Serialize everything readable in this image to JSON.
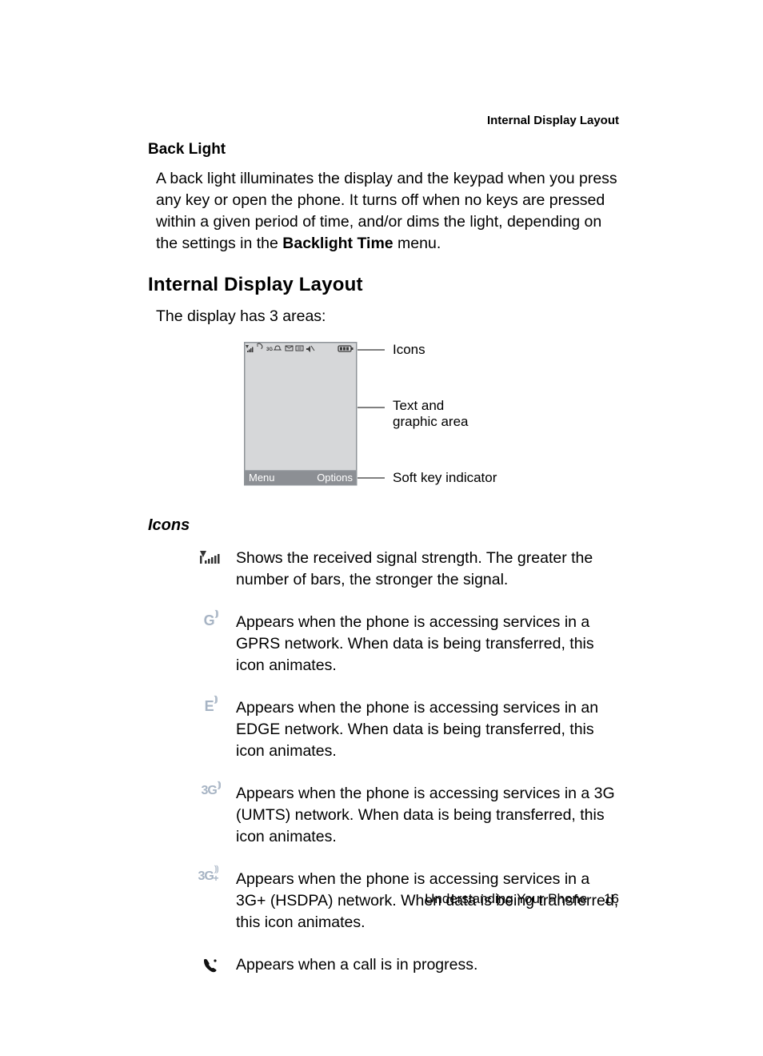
{
  "running_head": "Internal Display Layout",
  "section_backlight": {
    "heading": "Back Light",
    "para_before": "A back light illuminates the display and the keypad when you press any key or open the phone. It turns off when no keys are pressed within a given period of time, and/or dims the light, depending on the settings in the ",
    "bold": "Backlight Time",
    "para_after": " menu."
  },
  "section_layout": {
    "heading": "Internal Display Layout",
    "intro": "The display has 3 areas:",
    "diagram": {
      "menu": "Menu",
      "options": "Options",
      "label_icons": "Icons",
      "label_textarea_1": "Text and",
      "label_textarea_2": "graphic area",
      "label_softkey": "Soft key indicator"
    }
  },
  "section_icons": {
    "heading": "Icons",
    "items": [
      {
        "icon_name": "signal-strength-icon",
        "desc": "Shows the received signal strength. The greater the number of bars, the stronger the signal."
      },
      {
        "icon_name": "gprs-icon",
        "desc": "Appears when the phone is accessing services in a GPRS network. When data is being transferred, this icon animates."
      },
      {
        "icon_name": "edge-icon",
        "desc": "Appears when the phone is accessing services in an EDGE network. When data is being transferred, this icon animates."
      },
      {
        "icon_name": "3g-icon",
        "desc": "Appears when the phone is accessing services in a 3G (UMTS) network.  When data is being transferred, this icon animates."
      },
      {
        "icon_name": "3g-plus-icon",
        "desc": "Appears when the phone is accessing services in a 3G+ (HSDPA) network.  When data is being transferred, this icon animates."
      },
      {
        "icon_name": "call-in-progress-icon",
        "desc": "Appears when a call is in progress."
      }
    ]
  },
  "footer": {
    "chapter": "Understanding Your Phone",
    "page": "16"
  }
}
